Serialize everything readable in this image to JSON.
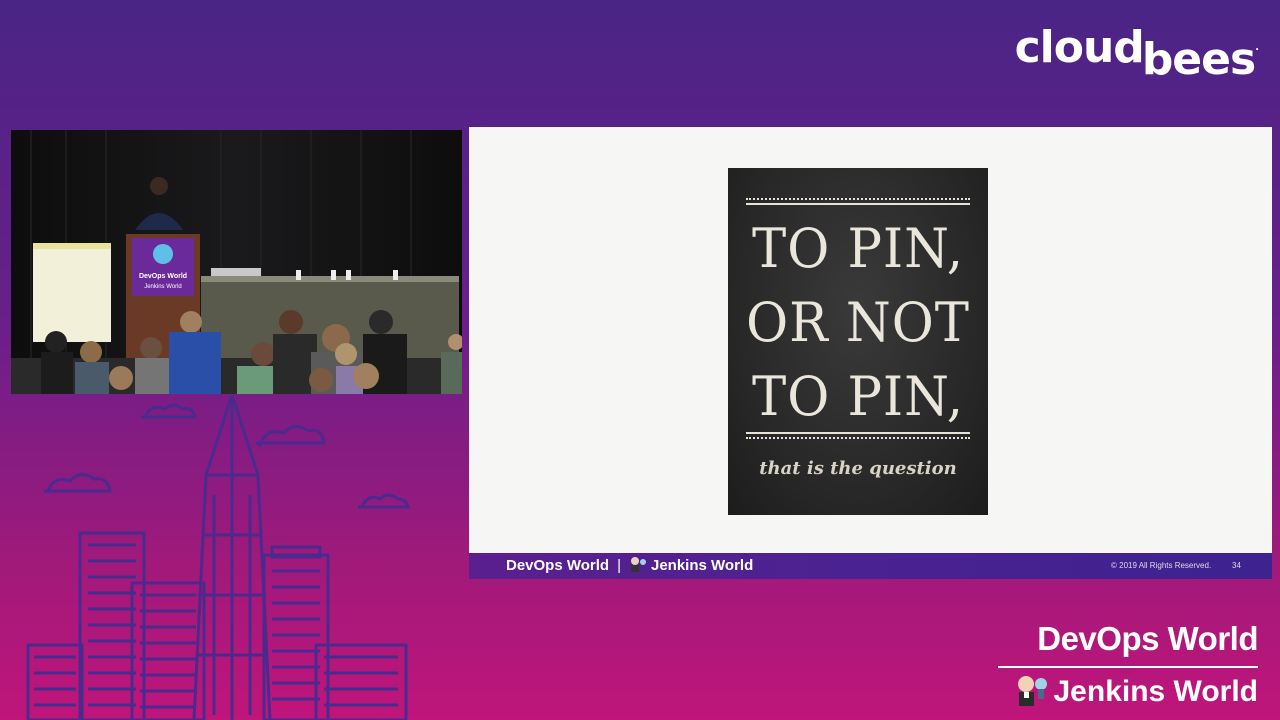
{
  "logo": {
    "part1": "cloud",
    "part2": "bees",
    "mark": "."
  },
  "video": {
    "podium_line1": "DevOps World",
    "podium_line2": "Jenkins World"
  },
  "slide": {
    "headline_line1": "TO PIN,",
    "headline_line2": "OR NOT",
    "headline_line3": "TO PIN,",
    "tagline": "that is the question",
    "footer_devops": "DevOps World",
    "footer_separator": "|",
    "footer_jenkins": "Jenkins World",
    "copyright": "© 2019 All Rights Reserved.",
    "page_number": "34"
  },
  "branding": {
    "devops": "DevOps World",
    "jenkins": "Jenkins World"
  },
  "colors": {
    "background_top": "#4a2486",
    "background_bottom": "#c0157a",
    "skyline_stroke": "#4b2a8e"
  }
}
